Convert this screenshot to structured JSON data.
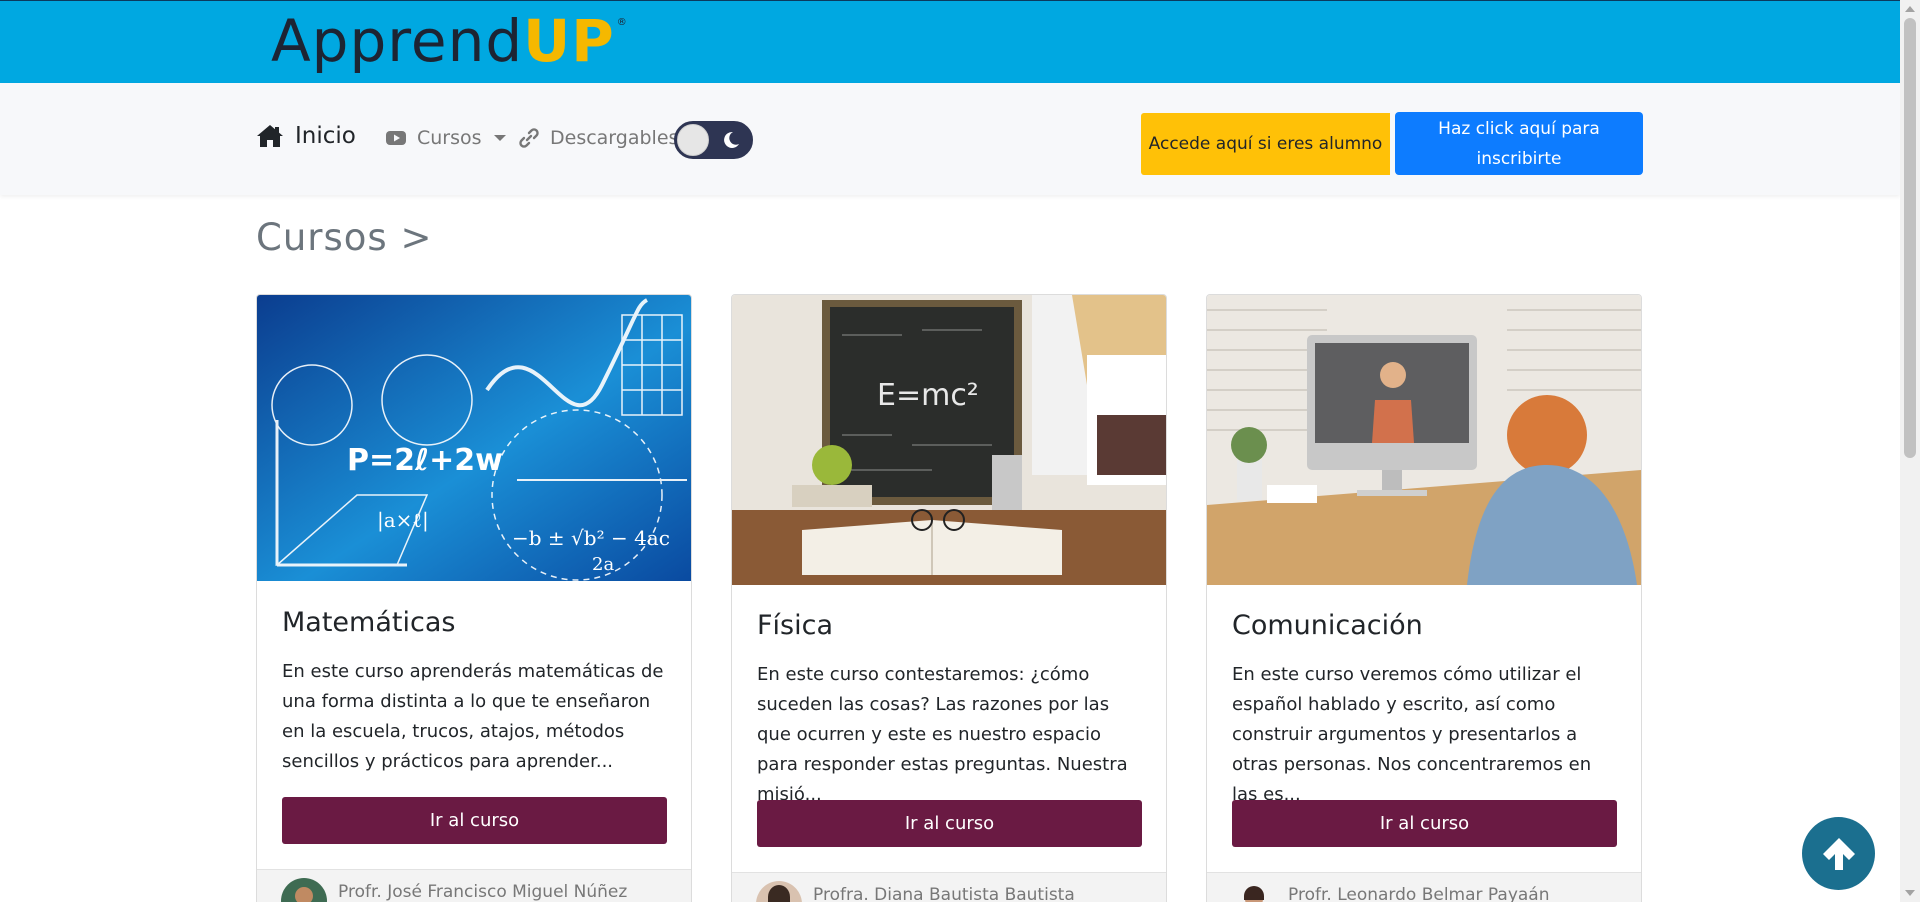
{
  "brand": {
    "part1": "Apprend",
    "part2": "UP",
    "registered": "®"
  },
  "nav": {
    "home_label": "Inicio",
    "courses_label": "Cursos",
    "downloads_label": "Descargables",
    "student_button": "Accede aquí si eres alumno",
    "enroll_button": "Haz click aquí para inscribirte"
  },
  "page": {
    "heading": "Cursos >"
  },
  "courses": [
    {
      "title": "Matemáticas",
      "description": "En este curso aprenderás matemáticas de una forma distinta a lo que te enseñaron en la escuela, trucos, atajos, métodos sencillos y prácticos para aprender...",
      "button": "Ir al curso",
      "teacher": "Profr. José Francisco Miguel Núñez"
    },
    {
      "title": "Física",
      "description": "En este curso contestaremos: ¿cómo suceden las cosas? Las razones por las que ocurren y este es nuestro espacio para responder estas preguntas. Nuestra misió...",
      "button": "Ir al curso",
      "teacher": "Profra. Diana Bautista Bautista"
    },
    {
      "title": "Comunicación",
      "description": "En este curso veremos cómo utilizar el español hablado y escrito, así como construir argumentos y presentarlos a otras personas. Nos concentraremos en las es...",
      "button": "Ir al curso",
      "teacher": "Profr. Leonardo Belmar Payaán"
    }
  ],
  "icons": [
    "home-icon",
    "youtube-icon",
    "link-icon",
    "moon-icon",
    "arrow-up-icon",
    "caret-down-icon"
  ],
  "colors": {
    "brand_bar": "#00a8e1",
    "student_btn": "#ffc107",
    "enroll_btn": "#0d7cff",
    "course_btn": "#6a1a43",
    "scroll_top": "#1b6f8f"
  }
}
